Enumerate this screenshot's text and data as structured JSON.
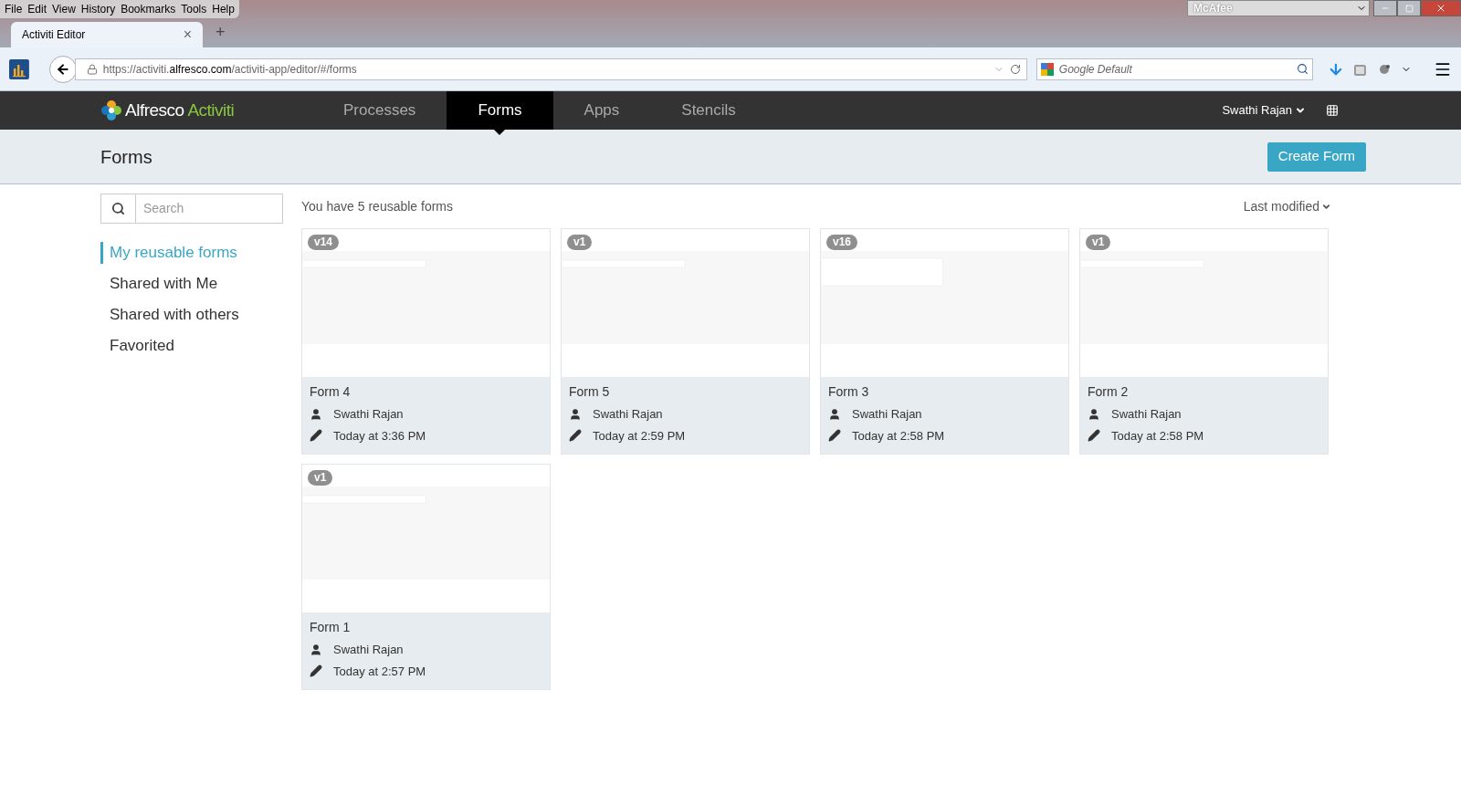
{
  "browser": {
    "menu": [
      "File",
      "Edit",
      "View",
      "History",
      "Bookmarks",
      "Tools",
      "Help"
    ],
    "tab": {
      "title": "Activiti Editor",
      "close": "×",
      "new_tab": "+"
    },
    "addon": "McAfee",
    "url": {
      "prefix": "https://activiti.",
      "domain": "alfresco.com",
      "path": "/activiti-app/editor/#/forms"
    },
    "search": {
      "placeholder": "Google Default"
    }
  },
  "app": {
    "logo": {
      "brand": "Alfresco",
      "product": "Activiti"
    },
    "nav": [
      {
        "label": "Processes",
        "selected": false
      },
      {
        "label": "Forms",
        "selected": true
      },
      {
        "label": "Apps",
        "selected": false
      },
      {
        "label": "Stencils",
        "selected": false
      }
    ],
    "user": "Swathi Rajan"
  },
  "header": {
    "title": "Forms",
    "create_button": "Create Form"
  },
  "sidebar": {
    "search": {
      "placeholder": "Search"
    },
    "items": [
      {
        "label": "My reusable forms",
        "selected": true
      },
      {
        "label": "Shared with Me",
        "selected": false
      },
      {
        "label": "Shared with others",
        "selected": false
      },
      {
        "label": "Favorited",
        "selected": false
      }
    ]
  },
  "summary": "You have 5 reusable forms",
  "sort": "Last modified",
  "forms": [
    {
      "version": "v14",
      "name": "Form 4",
      "owner": "Swathi Rajan",
      "modified": "Today at 3:36 PM"
    },
    {
      "version": "v1",
      "name": "Form 5",
      "owner": "Swathi Rajan",
      "modified": "Today at 2:59 PM"
    },
    {
      "version": "v16",
      "name": "Form 3",
      "owner": "Swathi Rajan",
      "modified": "Today at 2:58 PM"
    },
    {
      "version": "v1",
      "name": "Form 2",
      "owner": "Swathi Rajan",
      "modified": "Today at 2:58 PM"
    },
    {
      "version": "v1",
      "name": "Form 1",
      "owner": "Swathi Rajan",
      "modified": "Today at 2:57 PM"
    }
  ]
}
